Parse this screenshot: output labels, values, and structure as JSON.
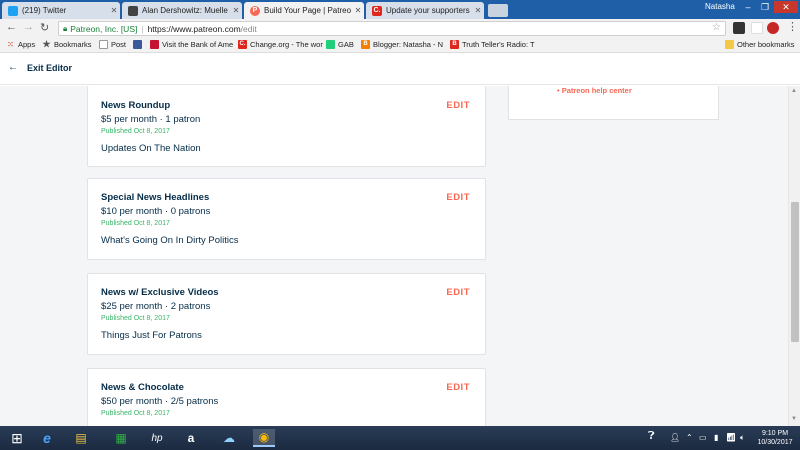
{
  "tabs": [
    {
      "title": "(219) Twitter",
      "icon": "twitter-icon",
      "color": "#1da1f2",
      "glyph": ""
    },
    {
      "title": "Alan Dershowitz: Muelle",
      "icon": "news-icon",
      "color": "#444444",
      "glyph": ""
    },
    {
      "title": "Build Your Page | Patreo",
      "icon": "patreon-icon",
      "color": "#f96854",
      "glyph": "P"
    },
    {
      "title": "Update your supporters",
      "icon": "change-org-icon",
      "color": "#e0271e",
      "glyph": "C."
    }
  ],
  "window": {
    "user": "Natasha",
    "minimize": "–",
    "restore": "❐",
    "close": "✕"
  },
  "address": {
    "secure_label": "Patreon, Inc. [US]",
    "url_domain": "https://www.patreon.com",
    "url_path": "/edit"
  },
  "bookmarks": [
    {
      "label": "Apps",
      "icon": "apps-icon",
      "color": "#d44638",
      "glyph": ""
    },
    {
      "label": "Bookmarks",
      "icon": "star-icon",
      "color": "#555555",
      "glyph": "★"
    },
    {
      "label": "Post",
      "icon": "document-icon",
      "color": "#777777",
      "glyph": ""
    },
    {
      "label": "",
      "icon": "flag-icon",
      "color": "#3b5998",
      "glyph": ""
    },
    {
      "label": "Visit the Bank of Ame",
      "icon": "bank-icon",
      "color": "#c41230",
      "glyph": ""
    },
    {
      "label": "Change.org - The wor",
      "icon": "change-org-icon",
      "color": "#e0271e",
      "glyph": "C."
    },
    {
      "label": "GAB",
      "icon": "gab-icon",
      "color": "#21cf7a",
      "glyph": ""
    },
    {
      "label": "Blogger: Natasha - N",
      "icon": "blogger-icon",
      "color": "#f57d00",
      "glyph": "B"
    },
    {
      "label": "Truth Teller's Radio: T",
      "icon": "radio-icon",
      "color": "#e0271e",
      "glyph": "B"
    }
  ],
  "other_bookmarks": "Other bookmarks",
  "header": {
    "exit_label": "Exit Editor"
  },
  "side_link": "Patreon help center",
  "tiers": [
    {
      "name": "News Roundup",
      "price": "$5 per month · 1 patron",
      "published": "Published Oct 8, 2017",
      "description": "Updates On The Nation",
      "edit": "EDIT"
    },
    {
      "name": "Special News Headlines",
      "price": "$10 per month · 0 patrons",
      "published": "Published Oct 8, 2017",
      "description": "What's Going On In Dirty Politics",
      "edit": "EDIT"
    },
    {
      "name": "News w/ Exclusive Videos",
      "price": "$25 per month · 2 patrons",
      "published": "Published Oct 8, 2017",
      "description": "Things Just For Patrons",
      "edit": "EDIT"
    },
    {
      "name": "News & Chocolate",
      "price": "$50 per month · 2/5 patrons",
      "published": "Published Oct 8, 2017",
      "description": "",
      "edit": "EDIT"
    }
  ],
  "taskbar": {
    "apps": [
      {
        "icon": "windows-start-icon",
        "glyph": "⊞"
      },
      {
        "icon": "internet-explorer-icon",
        "glyph": "e"
      },
      {
        "icon": "file-explorer-icon",
        "glyph": "▤"
      },
      {
        "icon": "store-icon",
        "glyph": "▦"
      },
      {
        "icon": "hp-icon",
        "glyph": "hp"
      },
      {
        "icon": "amazon-icon",
        "glyph": "a"
      },
      {
        "icon": "weather-icon",
        "glyph": "☁"
      },
      {
        "icon": "chrome-icon",
        "glyph": "◉"
      }
    ],
    "time": "9:10 PM",
    "date": "10/30/2017"
  },
  "colors": {
    "accent": "#f96854",
    "navy": "#052d49",
    "published": "#38b468"
  }
}
